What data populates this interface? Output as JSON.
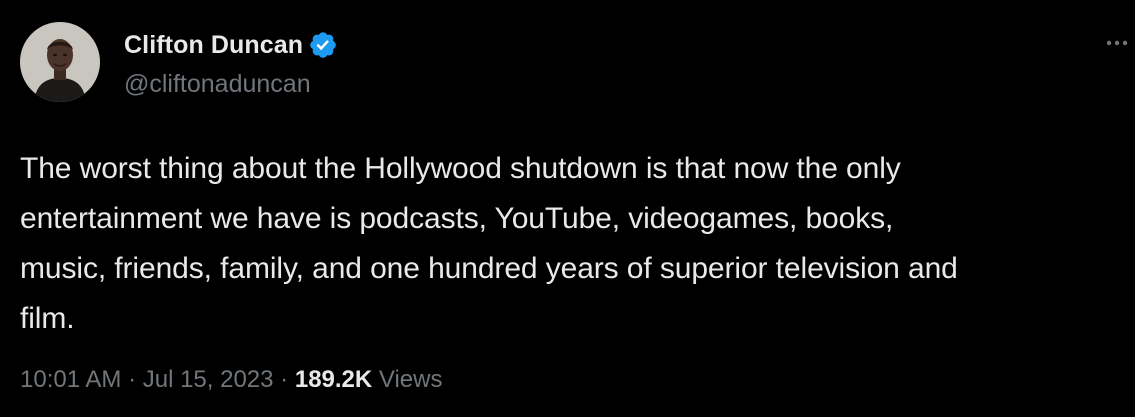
{
  "author": {
    "display_name": "Clifton Duncan",
    "handle": "@cliftonaduncan",
    "verified": true,
    "verified_color": "#1d9bf0",
    "avatar_icon": "profile-photo"
  },
  "tweet": {
    "text": "The worst thing about the Hollywood shutdown is that now the only\nentertainment we have is podcasts, YouTube, videogames, books,\nmusic, friends, family, and one hundred years of superior television and\nfilm.",
    "time": "10:01 AM",
    "separator": " · ",
    "date": "Jul 15, 2023",
    "views_count": "189.2K",
    "views_label": " Views"
  },
  "icons": {
    "more": "more-horizontal-icon",
    "verified": "verified-badge-icon"
  },
  "colors": {
    "background": "#000000",
    "primary_text": "#e7e9ea",
    "secondary_text": "#71767b"
  }
}
